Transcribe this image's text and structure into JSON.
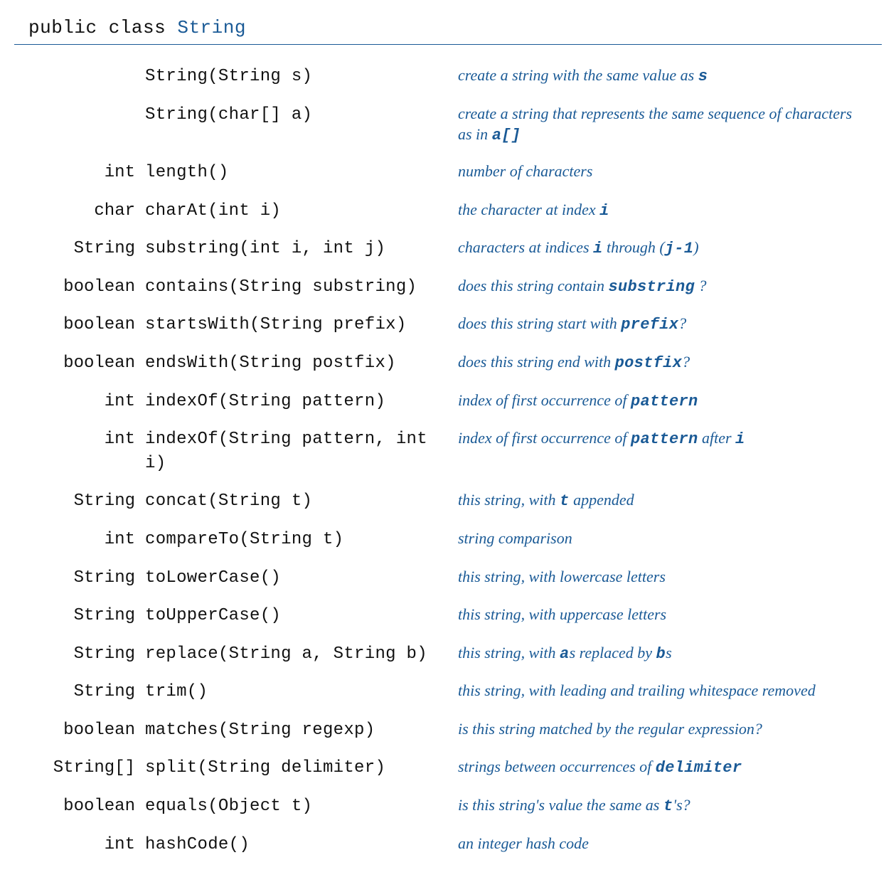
{
  "header": {
    "prefix": "public class ",
    "classname": "String"
  },
  "rows": [
    {
      "ret": "",
      "sig": "String(String s)",
      "desc": [
        {
          "t": "create a string with the same value as "
        },
        {
          "t": "s",
          "mono": true
        }
      ]
    },
    {
      "ret": "",
      "sig": "String(char[] a)",
      "desc": [
        {
          "t": "create a string that represents the same sequence of characters as in "
        },
        {
          "t": "a[]",
          "mono": true
        }
      ]
    },
    {
      "ret": "int",
      "sig": "length()",
      "desc": [
        {
          "t": "number of characters"
        }
      ]
    },
    {
      "ret": "char",
      "sig": "charAt(int i)",
      "desc": [
        {
          "t": "the character at index "
        },
        {
          "t": "i",
          "mono": true
        }
      ]
    },
    {
      "ret": "String",
      "sig": "substring(int i, int j)",
      "desc": [
        {
          "t": "characters at indices "
        },
        {
          "t": "i",
          "mono": true
        },
        {
          "t": " through ("
        },
        {
          "t": "j-1",
          "mono": true
        },
        {
          "t": ")"
        }
      ]
    },
    {
      "ret": "boolean",
      "sig": "contains(String substring)",
      "desc": [
        {
          "t": "does this string contain "
        },
        {
          "t": "substring",
          "mono": true
        },
        {
          "t": " ?"
        }
      ]
    },
    {
      "ret": "boolean",
      "sig": "startsWith(String prefix)",
      "desc": [
        {
          "t": "does this string start with "
        },
        {
          "t": "prefix",
          "mono": true
        },
        {
          "t": "?"
        }
      ]
    },
    {
      "ret": "boolean",
      "sig": "endsWith(String postfix)",
      "desc": [
        {
          "t": "does this string end with "
        },
        {
          "t": "postfix",
          "mono": true
        },
        {
          "t": "?"
        }
      ]
    },
    {
      "ret": "int",
      "sig": "indexOf(String pattern)",
      "desc": [
        {
          "t": "index of first occurrence of "
        },
        {
          "t": "pattern",
          "mono": true
        }
      ]
    },
    {
      "ret": "int",
      "sig": "indexOf(String pattern, int i)",
      "desc": [
        {
          "t": "index of first occurrence of "
        },
        {
          "t": "pattern",
          "mono": true
        },
        {
          "t": " after "
        },
        {
          "t": "i",
          "mono": true
        }
      ]
    },
    {
      "ret": "String",
      "sig": "concat(String t)",
      "desc": [
        {
          "t": "this string, with "
        },
        {
          "t": "t",
          "mono": true
        },
        {
          "t": " appended"
        }
      ]
    },
    {
      "ret": "int",
      "sig": "compareTo(String t)",
      "desc": [
        {
          "t": "string comparison"
        }
      ]
    },
    {
      "ret": "String",
      "sig": "toLowerCase()",
      "desc": [
        {
          "t": "this string, with lowercase letters"
        }
      ]
    },
    {
      "ret": "String",
      "sig": "toUpperCase()",
      "desc": [
        {
          "t": "this string, with uppercase letters"
        }
      ]
    },
    {
      "ret": "String",
      "sig": "replace(String a, String b)",
      "desc": [
        {
          "t": "this string, with "
        },
        {
          "t": "a",
          "mono": true
        },
        {
          "t": "s replaced by "
        },
        {
          "t": "b",
          "mono": true
        },
        {
          "t": "s"
        }
      ]
    },
    {
      "ret": "String",
      "sig": "trim()",
      "desc": [
        {
          "t": "this string, with leading and trailing whitespace removed"
        }
      ]
    },
    {
      "ret": "boolean",
      "sig": "matches(String regexp)",
      "desc": [
        {
          "t": "is this string matched by the regular expression?"
        }
      ]
    },
    {
      "ret": "String[]",
      "sig": "split(String delimiter)",
      "desc": [
        {
          "t": "strings between occurrences of "
        },
        {
          "t": "delimiter",
          "mono": true
        }
      ]
    },
    {
      "ret": "boolean",
      "sig": "equals(Object t)",
      "desc": [
        {
          "t": "is this string's value the same as "
        },
        {
          "t": "t",
          "mono": true
        },
        {
          "t": "'s?"
        }
      ]
    },
    {
      "ret": "int",
      "sig": "hashCode()",
      "desc": [
        {
          "t": "an integer hash code"
        }
      ]
    }
  ]
}
